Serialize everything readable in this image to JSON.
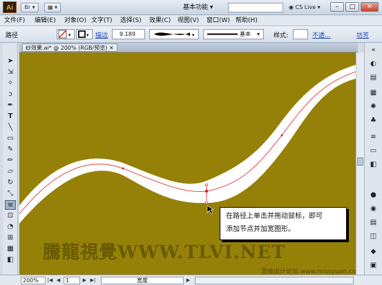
{
  "titlebar": {
    "logo": "Ai",
    "workspace": "基本功能",
    "cs_live": "CS Live",
    "minimize": "–",
    "maximize": "□",
    "close": "✕"
  },
  "menubar": {
    "items": [
      "文件(F)",
      "编辑(E)",
      "对象(O)",
      "文字(T)",
      "选择(S)",
      "效果(C)",
      "视图(V)",
      "窗口(W)",
      "帮助(H)"
    ]
  },
  "controlbar": {
    "object_type": "路径",
    "stroke_label": "描边",
    "stroke_weight": "9.189",
    "brush_label": "基本",
    "style_label": "样式:",
    "opacity_label": "不透...",
    "other_link": "坊芳"
  },
  "document": {
    "tab_label": "纱效果.ai* @ 200% (RGB/预览)",
    "canvas_color": "#968108",
    "path_fill": "#ffffff",
    "path_stroke": "#d82020"
  },
  "callout": {
    "line1": "在路径上单击并拖动鼠标，即可",
    "line2": "添加节点并加宽图形。"
  },
  "watermark": {
    "text": "騰龍視覺WWW.TLVI.NET",
    "sub": "思缘设计论坛 www.missyuan.com"
  },
  "statusbar": {
    "zoom": "200%",
    "page": "1",
    "info": "宽度"
  }
}
